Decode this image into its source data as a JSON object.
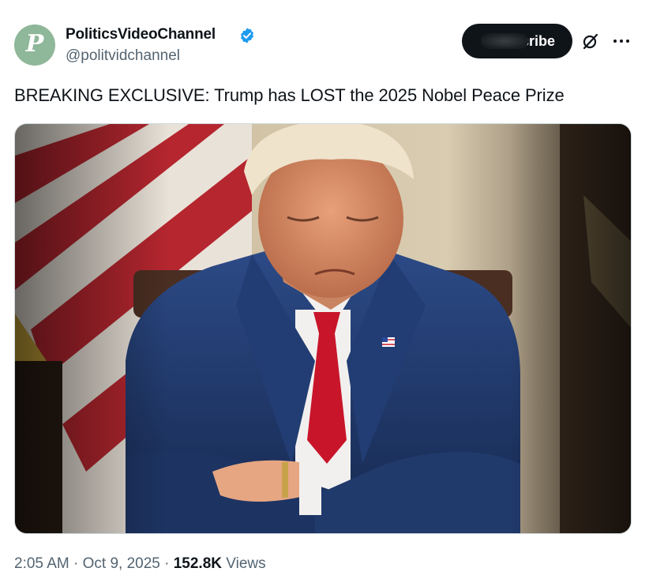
{
  "author": {
    "avatar_letter": "P",
    "display_name": "PoliticsVideoChannel",
    "handle": "@politvidchannel",
    "verified": true
  },
  "header": {
    "subscribe_label": "cribe",
    "grok_icon": "grok-slash-circle-icon",
    "more_icon": "more-horizontal-icon"
  },
  "tweet": {
    "text": "BREAKING EXCLUSIVE: Trump has LOST the 2025 Nobel Peace Prize"
  },
  "media": {
    "description_icon": "photo-man-in-suit-arms-crossed"
  },
  "meta": {
    "time": "2:05 AM",
    "separator": "·",
    "date": "Oct 9, 2025",
    "views_count": "152.8K",
    "views_label": "Views"
  },
  "colors": {
    "accent": "#1d9bf0",
    "text_primary": "#0f1419",
    "text_secondary": "#536471",
    "avatar_bg": "#8fb79a"
  }
}
